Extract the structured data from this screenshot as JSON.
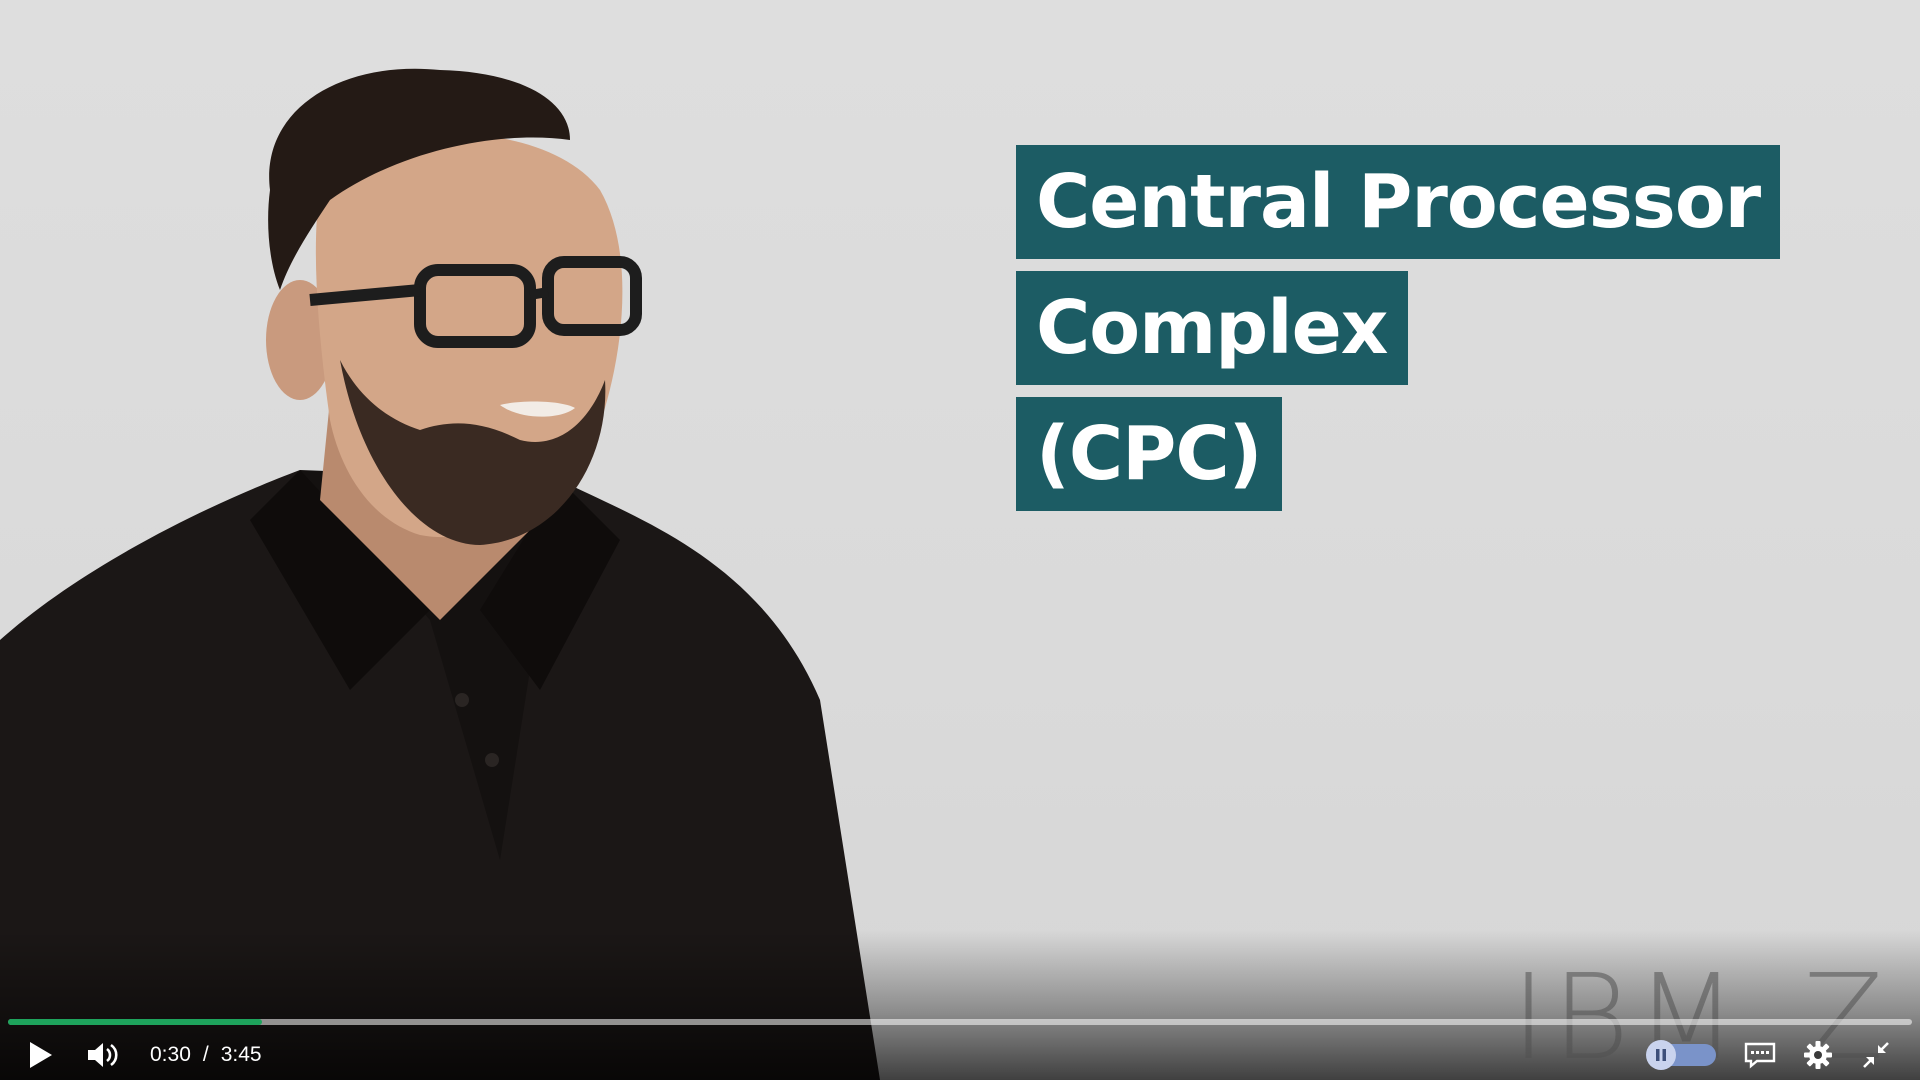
{
  "video": {
    "title_lines": [
      "Central Processor",
      "Complex",
      "(CPC)"
    ],
    "watermark": [
      "IBM",
      "Z"
    ],
    "progress_fraction": 0.1333
  },
  "controls": {
    "current_time": "0:30",
    "separator": "/",
    "duration": "3:45",
    "icons": [
      "play-icon",
      "volume-icon",
      "pause-icon",
      "captions-icon",
      "gear-icon",
      "exit-fullscreen-icon"
    ]
  },
  "colors": {
    "title_background": "#1c5c64",
    "progress_played": "#1ea35c",
    "toggle_track": "#7a93c9"
  }
}
